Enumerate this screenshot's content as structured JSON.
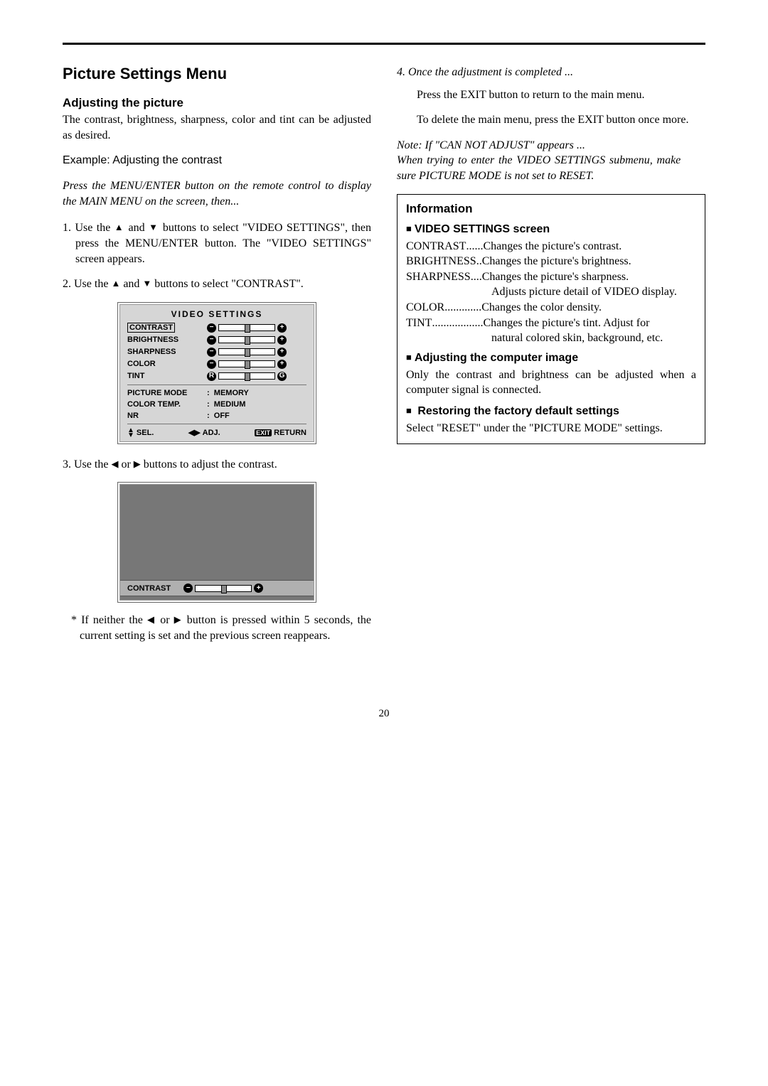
{
  "page_number": "20",
  "left": {
    "h1": "Picture Settings Menu",
    "h2": "Adjusting the picture",
    "intro": "The contrast, brightness, sharpness, color and tint can be adjusted as desired.",
    "example": "Example: Adjusting the contrast",
    "press_intro": "Press the MENU/ENTER button on the remote control to display the MAIN MENU on the screen, then...",
    "step1_a": "1. Use the ",
    "step1_b": " and ",
    "step1_c": " buttons to select \"VIDEO SETTINGS\", then press the MENU/ENTER button. The \"VIDEO SETTINGS\" screen appears.",
    "step2_a": "2. Use the ",
    "step2_b": " and ",
    "step2_c": " buttons to select \"CONTRAST\".",
    "step3_a": "3. Use the ",
    "step3_b": " or ",
    "step3_c": " buttons to adjust the contrast.",
    "footnote_a": "* If neither the",
    "footnote_b": " or ",
    "footnote_c": "button is pressed within 5 seconds, the current setting is set and the previous screen reappears."
  },
  "osd": {
    "title": "VIDEO SETTINGS",
    "rows": {
      "contrast": "CONTRAST",
      "brightness": "BRIGHTNESS",
      "sharpness": "SHARPNESS",
      "color": "COLOR",
      "tint": "TINT",
      "tint_l": "R",
      "tint_r": "G",
      "picture_mode": "PICTURE MODE",
      "picture_mode_v": "MEMORY",
      "color_temp": "COLOR TEMP.",
      "color_temp_v": "MEDIUM",
      "nr": "NR",
      "nr_v": "OFF"
    },
    "footer": {
      "sel": "SEL.",
      "adj": "ADJ.",
      "exit": "EXIT",
      "return": "RETURN"
    },
    "big_label": "CONTRAST"
  },
  "right": {
    "step4": "4. Once the adjustment is completed ...",
    "step4_a": "Press the EXIT button to return to the main menu.",
    "step4_b": "To delete the main menu, press the EXIT button once more.",
    "note_a": "Note: If \"CAN NOT ADJUST\" appears ...",
    "note_b": "When trying to enter the VIDEO SETTINGS submenu, make sure PICTURE MODE is not set to RESET."
  },
  "info": {
    "title": "Information",
    "sub1": "VIDEO SETTINGS screen",
    "contrast_t": "CONTRAST",
    "contrast_dots": " ...... ",
    "contrast_d": "Changes the picture's contrast.",
    "brightness_t": "BRIGHTNESS",
    "brightness_dots": " .. ",
    "brightness_d": "Changes the picture's brightness.",
    "sharpness_t": "SHARPNESS",
    "sharpness_dots": " .... ",
    "sharpness_d": "Changes the picture's sharpness. Adjusts picture detail of VIDEO display.",
    "sharpness_d1": "Changes the picture's sharpness.",
    "sharpness_d2": "Adjusts picture detail of VIDEO display.",
    "color_t": "COLOR",
    "color_dots": " ............. ",
    "color_d": "Changes the color density.",
    "tint_t": "TINT",
    "tint_dots": " .................. ",
    "tint_d1": "Changes the picture's tint. Adjust for",
    "tint_d2": "natural colored skin, background, etc.",
    "sub2": "Adjusting the computer image",
    "p2": "Only the contrast and brightness can be adjusted when a computer signal is connected.",
    "sub3": "Restoring the factory default settings",
    "p3": "Select \"RESET\" under the \"PICTURE MODE\" settings."
  }
}
